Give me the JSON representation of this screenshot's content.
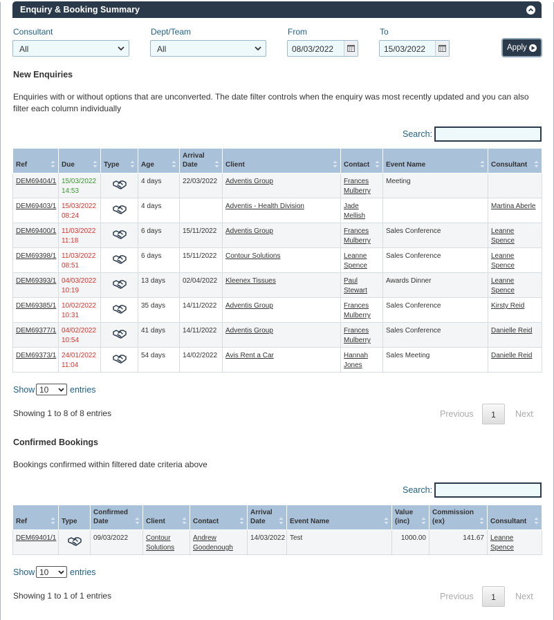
{
  "header": {
    "title": "Enquiry & Booking Summary"
  },
  "filters": {
    "consultant_label": "Consultant",
    "consultant_value": "All",
    "dept_label": "Dept/Team",
    "dept_value": "All",
    "from_label": "From",
    "from_value": "08/03/2022",
    "to_label": "To",
    "to_value": "15/03/2022",
    "apply_label": "Apply"
  },
  "enquiries": {
    "title": "New Enquiries",
    "description": "Enquiries with or without options that are unconverted. The date filter controls when the enquiry was most recently updated and you can also filter each column individually",
    "search_label": "Search:",
    "columns": [
      "Ref",
      "Due",
      "Type",
      "Age",
      "Arrival Date",
      "Client",
      "Contact",
      "Event Name",
      "Consultant"
    ],
    "rows": [
      {
        "ref": "DEM69404/1",
        "due_date": "15/03/2022",
        "due_time": "14:53",
        "due_status": "green",
        "age": "4 days",
        "arrival": "22/03/2022",
        "client": "Adventis Group",
        "contact": "Frances Mulberry",
        "event": "Meeting",
        "consultant": ""
      },
      {
        "ref": "DEM69403/1",
        "due_date": "15/03/2022",
        "due_time": "08:24",
        "due_status": "red",
        "age": "4 days",
        "arrival": "",
        "client": "Adventis - Health Division",
        "contact": "Jade Mellish",
        "event": "",
        "consultant": "Martina Aberle"
      },
      {
        "ref": "DEM69400/1",
        "due_date": "11/03/2022",
        "due_time": "11:18",
        "due_status": "red",
        "age": "6 days",
        "arrival": "15/11/2022",
        "client": "Adventis Group",
        "contact": "Frances Mulberry",
        "event": "Sales Conference",
        "consultant": "Leanne Spence"
      },
      {
        "ref": "DEM69398/1",
        "due_date": "11/03/2022",
        "due_time": "08:51",
        "due_status": "red",
        "age": "6 days",
        "arrival": "15/11/2022",
        "client": "Contour Solutions",
        "contact": "Leanne Spence",
        "event": "Sales Conference",
        "consultant": "Leanne Spence"
      },
      {
        "ref": "DEM69393/1",
        "due_date": "04/03/2022",
        "due_time": "10:19",
        "due_status": "red",
        "age": "13 days",
        "arrival": "02/04/2022",
        "client": "Kleenex Tissues",
        "contact": "Paul Stewart",
        "event": "Awards Dinner",
        "consultant": "Leanne Spence"
      },
      {
        "ref": "DEM69385/1",
        "due_date": "10/02/2022",
        "due_time": "10:31",
        "due_status": "red",
        "age": "35 days",
        "arrival": "14/11/2022",
        "client": "Adventis Group",
        "contact": "Frances Mulberry",
        "event": "Sales Conference",
        "consultant": "Kirsty Reid"
      },
      {
        "ref": "DEM69377/1",
        "due_date": "04/02/2022",
        "due_time": "10:54",
        "due_status": "red",
        "age": "41 days",
        "arrival": "14/11/2022",
        "client": "Adventis Group",
        "contact": "Frances Mulberry",
        "event": "Sales Conference",
        "consultant": "Danielle Reid"
      },
      {
        "ref": "DEM69373/1",
        "due_date": "24/01/2022",
        "due_time": "11:04",
        "due_status": "red",
        "age": "54 days",
        "arrival": "14/02/2022",
        "client": "Avis Rent a Car",
        "contact": "Hannah Jones",
        "event": "Sales Meeting",
        "consultant": "Danielle Reid"
      }
    ],
    "show_label": "Show",
    "show_value": "10",
    "entries_label": "entries",
    "info": "Showing 1 to 8 of 8 entries",
    "prev_label": "Previous",
    "page": "1",
    "next_label": "Next"
  },
  "bookings": {
    "title": "Confirmed Bookings",
    "description": "Bookings confirmed within filtered date criteria above",
    "search_label": "Search:",
    "columns": [
      "Ref",
      "Type",
      "Confirmed Date",
      "Client",
      "Contact",
      "Arrival Date",
      "Event Name",
      "Value (inc)",
      "Commission (ex)",
      "Consultant"
    ],
    "rows": [
      {
        "ref": "DEM69401/1",
        "confirmed": "09/03/2022",
        "client": "Contour Solutions",
        "contact": "Andrew Goodenough",
        "arrival": "14/03/2022",
        "event": "Test",
        "value": "1000.00",
        "commission": "141.67",
        "consultant": "Leanne Spence"
      }
    ],
    "show_label": "Show",
    "show_value": "10",
    "entries_label": "entries",
    "info": "Showing 1 to 1 of 1 entries",
    "prev_label": "Previous",
    "page": "1",
    "next_label": "Next"
  }
}
